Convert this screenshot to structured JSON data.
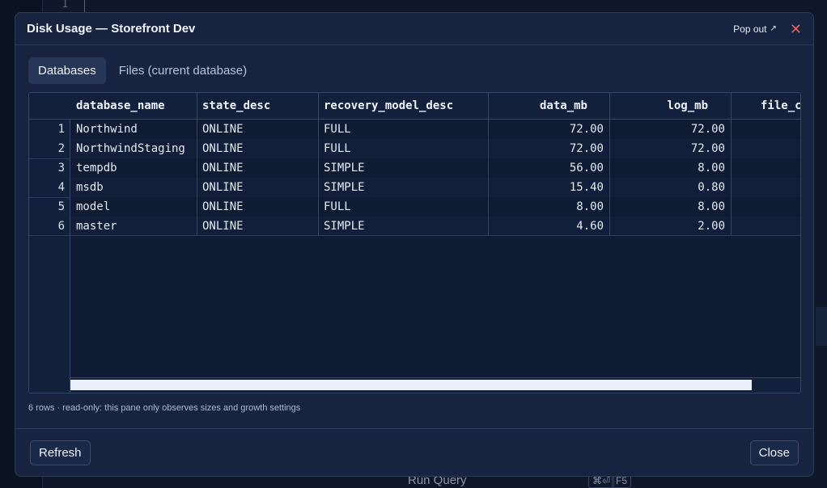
{
  "background": {
    "line_number": "1",
    "run_query_label": "Run Query",
    "shortcut_keys": [
      "⌘⏎",
      "F5"
    ]
  },
  "dialog": {
    "title": "Disk Usage — Storefront Dev",
    "popout_label": "Pop out",
    "popout_icon": "arrow-up-right-icon",
    "close_icon": "close-icon",
    "tabs": [
      {
        "label": "Databases",
        "active": true
      },
      {
        "label": "Files (current database)",
        "active": false
      }
    ],
    "grid": {
      "columns": [
        "database_name",
        "state_desc",
        "recovery_model_desc",
        "data_mb",
        "log_mb",
        "file_c"
      ],
      "rows": [
        {
          "n": "1",
          "cells": [
            "Northwind",
            "ONLINE",
            "FULL",
            "72.00",
            "72.00",
            ""
          ]
        },
        {
          "n": "2",
          "cells": [
            "NorthwindStaging",
            "ONLINE",
            "FULL",
            "72.00",
            "72.00",
            ""
          ]
        },
        {
          "n": "3",
          "cells": [
            "tempdb",
            "ONLINE",
            "SIMPLE",
            "56.00",
            "8.00",
            ""
          ]
        },
        {
          "n": "4",
          "cells": [
            "msdb",
            "ONLINE",
            "SIMPLE",
            "15.40",
            "0.80",
            ""
          ]
        },
        {
          "n": "5",
          "cells": [
            "model",
            "ONLINE",
            "FULL",
            "8.00",
            "8.00",
            ""
          ]
        },
        {
          "n": "6",
          "cells": [
            "master",
            "ONLINE",
            "SIMPLE",
            "4.60",
            "2.00",
            ""
          ]
        }
      ]
    },
    "status_text": "6 rows · read-only: this pane only observes sizes and growth settings",
    "refresh_label": "Refresh",
    "close_label": "Close"
  },
  "colors": {
    "accent_close": "#ef5a5a",
    "dialog_bg": "#17233f",
    "grid_bg": "#0f1a33"
  }
}
